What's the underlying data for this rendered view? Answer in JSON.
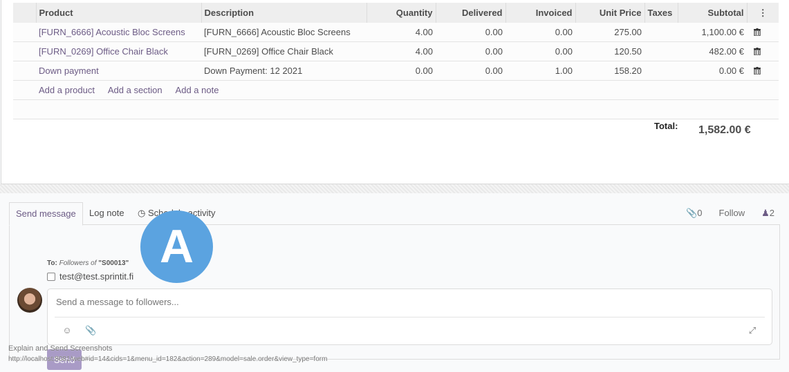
{
  "order_lines": {
    "columns": [
      "Product",
      "Description",
      "Quantity",
      "Delivered",
      "Invoiced",
      "Unit Price",
      "Taxes",
      "Subtotal"
    ],
    "rows": [
      {
        "product": "[FURN_6666] Acoustic Bloc Screens",
        "description": "[FURN_6666] Acoustic Bloc Screens",
        "quantity": "4.00",
        "delivered": "0.00",
        "invoiced": "0.00",
        "unit_price": "275.00",
        "taxes": "",
        "subtotal": "1,100.00 €"
      },
      {
        "product": "[FURN_0269] Office Chair Black",
        "description": "[FURN_0269] Office Chair Black",
        "quantity": "4.00",
        "delivered": "0.00",
        "invoiced": "0.00",
        "unit_price": "120.50",
        "taxes": "",
        "subtotal": "482.00 €"
      },
      {
        "product": "Down payment",
        "description": "Down Payment: 12 2021",
        "quantity": "0.00",
        "delivered": "0.00",
        "invoiced": "1.00",
        "unit_price": "158.20",
        "taxes": "",
        "subtotal": "0.00 €"
      }
    ],
    "add_links": [
      "Add a product",
      "Add a section",
      "Add a note"
    ]
  },
  "totals": {
    "label": "Total:",
    "value": "1,582.00 €"
  },
  "chatter": {
    "tabs": [
      "Send message",
      "Log note",
      "Schedule activity"
    ],
    "attachments_count": "0",
    "follow_label": "Follow",
    "followers_count": "2",
    "to_prefix": "To:",
    "to_followers": "Followers of",
    "to_record": "\"S00013\"",
    "recipient": "test@test.sprintit.fi",
    "message_placeholder": "Send a message to followers...",
    "send_label": "Send"
  },
  "overlay": {
    "marker_label": "A"
  },
  "status": {
    "line1": "Explain and Send Screenshots",
    "line2": "http://localhost:8081/web#id=14&cids=1&menu_id=182&action=289&model=sale.order&view_type=form"
  },
  "colors": {
    "link": "#6c5b85",
    "send_button": "#a99bc6",
    "marker": "#5ba3e0"
  }
}
